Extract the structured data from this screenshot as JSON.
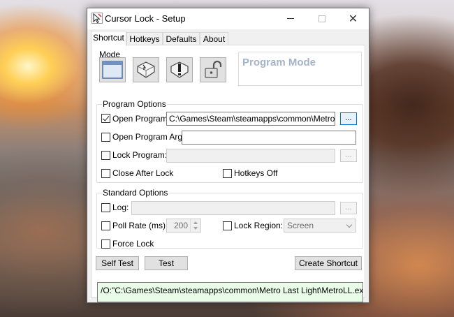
{
  "window": {
    "title": "Cursor Lock - Setup",
    "minimize_glyph": "",
    "maximize_glyph": "",
    "close_glyph": "✕"
  },
  "tabs": [
    {
      "label": "Shortcut",
      "active": true
    },
    {
      "label": "Hotkeys",
      "active": false
    },
    {
      "label": "Defaults",
      "active": false
    },
    {
      "label": "About",
      "active": false
    }
  ],
  "mode": {
    "legend": "Mode",
    "buttons": [
      {
        "icon": "window-icon"
      },
      {
        "icon": "key-icon"
      },
      {
        "icon": "warning-icon"
      },
      {
        "icon": "unlock-padlock-icon"
      }
    ],
    "current_mode_label": "Program Mode"
  },
  "program_options": {
    "legend": "Program Options",
    "open_program": {
      "label": "Open Program:",
      "checked": true,
      "value": "C:\\Games\\Steam\\steamapps\\common\\Metro Last",
      "browse_label": "..."
    },
    "open_program_args": {
      "label": "Open Program Args:",
      "checked": false,
      "value": ""
    },
    "lock_program": {
      "label": "Lock Program:",
      "checked": false,
      "value": "",
      "browse_label": "..."
    },
    "close_after_lock": {
      "label": "Close After Lock",
      "checked": false
    },
    "hotkeys_off": {
      "label": "Hotkeys Off",
      "checked": false
    }
  },
  "standard_options": {
    "legend": "Standard Options",
    "log": {
      "label": "Log:",
      "checked": false,
      "value": "",
      "browse_label": "..."
    },
    "poll_rate": {
      "label": "Poll Rate (ms):",
      "checked": false,
      "value": "200"
    },
    "lock_region": {
      "label": "Lock Region:",
      "checked": false,
      "selected": "Screen"
    },
    "force_lock": {
      "label": "Force Lock",
      "checked": false
    }
  },
  "buttons": {
    "self_test": "Self Test",
    "test": "Test",
    "create_shortcut": "Create Shortcut"
  },
  "command_line": "/O:\"C:\\Games\\Steam\\steamapps\\common\\Metro Last Light\\MetroLL.exe\"",
  "colors": {
    "program_mode_text": "#a4b4c8",
    "command_line_bg": "#e8fce8",
    "accent": "#0078d7"
  }
}
